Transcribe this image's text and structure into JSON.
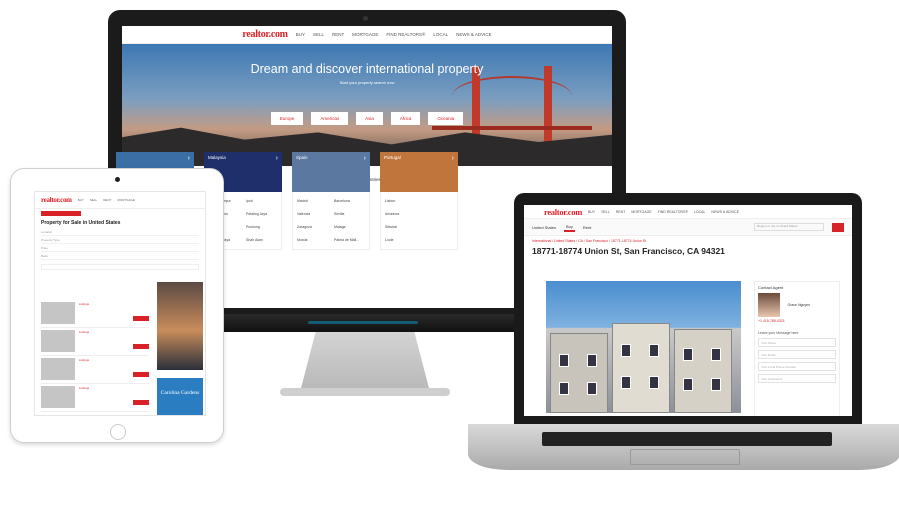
{
  "imac": {
    "logo": "realtor.com",
    "nav": [
      "BUY",
      "SELL",
      "RENT",
      "MORTGAGE",
      "FIND REALTORS®",
      "LOCAL",
      "NEWS & ADVICE"
    ],
    "hero_title": "Dream and discover international property",
    "hero_subtitle": "Start your property search now",
    "regions": [
      "Europe",
      "Americas",
      "Asia",
      "Africa",
      "Oceania"
    ],
    "top_countries_label": "Top Countries",
    "countries": [
      {
        "name": "",
        "links": [
          "Sydney",
          "",
          "Adelaide",
          "",
          "Gold Brooklyn",
          "",
          "Perth",
          ""
        ],
        "color": "#3a6ea5"
      },
      {
        "name": "Malaysia",
        "links": [
          "Kuala Lumpur",
          "Ipoh",
          "Johor Bahru",
          "Petaling Jaya",
          "Ipoh",
          "Puchong",
          "Petaling Jaya",
          "Shah Alam"
        ],
        "color": "#1f2f6b"
      },
      {
        "name": "Spain",
        "links": [
          "Madrid",
          "Barcelona",
          "Valencia",
          "Sevilla",
          "Zaragoza",
          "Malaga",
          "Murcia",
          "Palma de Mall..."
        ],
        "color": "#5a78a0"
      },
      {
        "name": "Portugal",
        "links": [
          "Lisbon",
          "",
          "Amadora",
          "",
          "Setubal",
          "",
          "Loule",
          ""
        ],
        "color": "#c0753d"
      }
    ]
  },
  "ipad": {
    "logo": "realtor.com",
    "nav": [
      "BUY",
      "SELL",
      "RENT",
      "MORTGAGE",
      "FIND REALTORS®",
      "NEWS & ADVICE"
    ],
    "title": "Property for Sale in United States",
    "filters": [
      "Location",
      "Property Type",
      "Price",
      "Beds",
      "Baths"
    ],
    "results": [
      "Listings",
      "Listings",
      "Listings",
      "Listings"
    ],
    "ad_text": "Carolina Gardens"
  },
  "laptop": {
    "logo": "realtor.com",
    "nav": [
      "BUY",
      "SELL",
      "RENT",
      "MORTGAGE",
      "FIND REALTORS®",
      "LOCAL",
      "NEWS & ADVICE"
    ],
    "country": "United States",
    "tabs": [
      "Buy",
      "Rent"
    ],
    "search_placeholder": "Region or city in United States",
    "breadcrumb": "International / United States / CA / San Francisco / 18771-18774 Union St",
    "address": "18771-18774  Union St, San Francisco, CA 94321",
    "agent_heading": "Contact Agent",
    "agent_name": "Grace Nguyen",
    "agent_phone": "+1 415-785-4321",
    "message_label": "Leave your Message here",
    "fields": [
      "Your Name",
      "Your Email",
      "Your Local Phone Number",
      "Your Comments"
    ]
  }
}
